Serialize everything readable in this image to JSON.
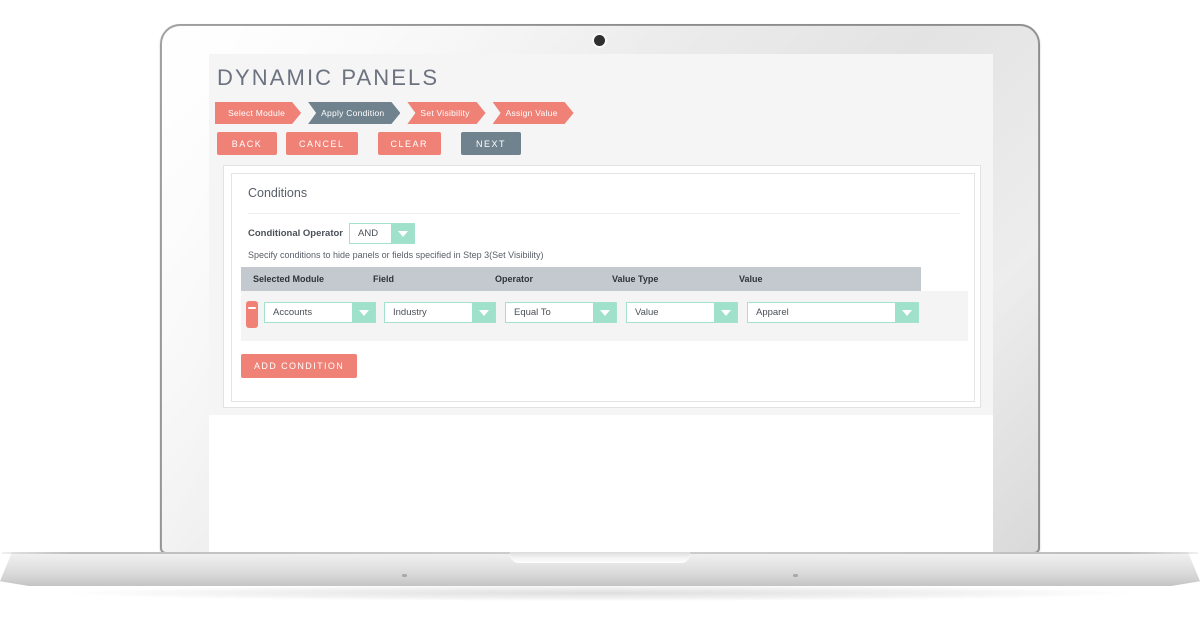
{
  "app": {
    "title": "DYNAMIC PANELS"
  },
  "steps": [
    {
      "label": "Select Module",
      "state": "done",
      "color": "#ef8176"
    },
    {
      "label": "Apply Condition",
      "state": "current",
      "color": "#70828e"
    },
    {
      "label": "Set Visibility",
      "state": "pending",
      "color": "#ef8176"
    },
    {
      "label": "Assign Value",
      "state": "pending",
      "color": "#ef8176"
    }
  ],
  "toolbar": {
    "back_label": "BACK",
    "cancel_label": "CANCEL",
    "clear_label": "CLEAR",
    "next_label": "NEXT"
  },
  "panel": {
    "title": "Conditions",
    "conditional_operator_label": "Conditional Operator",
    "conditional_operator_value": "AND",
    "helper_text": "Specify conditions to hide panels or fields specified in Step 3(Set Visibility)",
    "table": {
      "headers": [
        "Selected Module",
        "Field",
        "Operator",
        "Value Type",
        "Value"
      ],
      "rows": [
        {
          "selected_module": "Accounts",
          "field": "Industry",
          "operator": "Equal To",
          "value_type": "Value",
          "value": "Apparel"
        }
      ]
    },
    "add_condition_label": "ADD CONDITION"
  },
  "theme": {
    "coral": "#ef8176",
    "slate": "#70828e",
    "mint": "#9fe1cb",
    "mint_border": "#a5e2cd",
    "table_header_bg": "#c3c9cf",
    "page_bg": "#f5f5f5"
  }
}
